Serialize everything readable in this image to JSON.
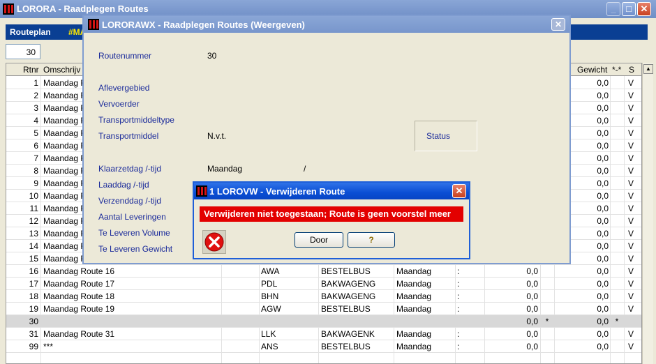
{
  "main_window": {
    "title": "LORORA - Raadplegen Routes",
    "routeplan_label": "Routeplan",
    "routeplan_code": "#MA",
    "count_value": "30"
  },
  "grid": {
    "headers": {
      "rtnr": "Rtnr",
      "omschrijving": "Omschrijv",
      "gewicht": "Gewicht",
      "flag": "*-*",
      "s": "S"
    },
    "rows": [
      {
        "rtnr": "1",
        "omschrijving": "Maandag Ro",
        "code": "",
        "vervoer": "",
        "dag": "",
        "tijd": "",
        "volume": "",
        "mark": "",
        "gewicht": "0,0",
        "flag": "",
        "s": "V"
      },
      {
        "rtnr": "2",
        "omschrijving": "Maandag Ro",
        "code": "",
        "vervoer": "",
        "dag": "",
        "tijd": "",
        "volume": "",
        "mark": "",
        "gewicht": "0,0",
        "flag": "",
        "s": "V"
      },
      {
        "rtnr": "3",
        "omschrijving": "Maandag Ro",
        "code": "",
        "vervoer": "",
        "dag": "",
        "tijd": "",
        "volume": "",
        "mark": "",
        "gewicht": "0,0",
        "flag": "",
        "s": "V"
      },
      {
        "rtnr": "4",
        "omschrijving": "Maandag Ro",
        "code": "",
        "vervoer": "",
        "dag": "",
        "tijd": "",
        "volume": "",
        "mark": "",
        "gewicht": "0,0",
        "flag": "",
        "s": "V"
      },
      {
        "rtnr": "5",
        "omschrijving": "Maandag Ro",
        "code": "",
        "vervoer": "",
        "dag": "",
        "tijd": "",
        "volume": "",
        "mark": "",
        "gewicht": "0,0",
        "flag": "",
        "s": "V"
      },
      {
        "rtnr": "6",
        "omschrijving": "Maandag Ro",
        "code": "",
        "vervoer": "",
        "dag": "",
        "tijd": "",
        "volume": "",
        "mark": "",
        "gewicht": "0,0",
        "flag": "",
        "s": "V"
      },
      {
        "rtnr": "7",
        "omschrijving": "Maandag Ro",
        "code": "",
        "vervoer": "",
        "dag": "",
        "tijd": "",
        "volume": "",
        "mark": "",
        "gewicht": "0,0",
        "flag": "",
        "s": "V"
      },
      {
        "rtnr": "8",
        "omschrijving": "Maandag Ro",
        "code": "",
        "vervoer": "",
        "dag": "",
        "tijd": "",
        "volume": "",
        "mark": "",
        "gewicht": "0,0",
        "flag": "",
        "s": "V"
      },
      {
        "rtnr": "9",
        "omschrijving": "Maandag Ro",
        "code": "",
        "vervoer": "",
        "dag": "",
        "tijd": "",
        "volume": "",
        "mark": "",
        "gewicht": "0,0",
        "flag": "",
        "s": "V"
      },
      {
        "rtnr": "10",
        "omschrijving": "Maandag Ro",
        "code": "",
        "vervoer": "",
        "dag": "",
        "tijd": "",
        "volume": "",
        "mark": "",
        "gewicht": "0,0",
        "flag": "",
        "s": "V"
      },
      {
        "rtnr": "11",
        "omschrijving": "Maandag Ro",
        "code": "",
        "vervoer": "",
        "dag": "",
        "tijd": "",
        "volume": "",
        "mark": "",
        "gewicht": "0,0",
        "flag": "",
        "s": "V"
      },
      {
        "rtnr": "12",
        "omschrijving": "Maandag Ro",
        "code": "",
        "vervoer": "",
        "dag": "",
        "tijd": "",
        "volume": "",
        "mark": "",
        "gewicht": "0,0",
        "flag": "",
        "s": "V"
      },
      {
        "rtnr": "13",
        "omschrijving": "Maandag Ro",
        "code": "",
        "vervoer": "",
        "dag": "",
        "tijd": "",
        "volume": "",
        "mark": "",
        "gewicht": "0,0",
        "flag": "",
        "s": "V"
      },
      {
        "rtnr": "14",
        "omschrijving": "Maandag Ro",
        "code": "",
        "vervoer": "",
        "dag": "",
        "tijd": "",
        "volume": "",
        "mark": "",
        "gewicht": "0,0",
        "flag": "",
        "s": "V"
      },
      {
        "rtnr": "15",
        "omschrijving": "Maandag Ro",
        "code": "",
        "vervoer": "",
        "dag": "",
        "tijd": "",
        "volume": "",
        "mark": "",
        "gewicht": "0,0",
        "flag": "",
        "s": "V"
      },
      {
        "rtnr": "16",
        "omschrijving": "Maandag Route 16",
        "code": "AWA",
        "vervoer": "BESTELBUS",
        "dag": "Maandag",
        "tijd": ":",
        "volume": "0,0",
        "mark": "",
        "gewicht": "0,0",
        "flag": "",
        "s": "V"
      },
      {
        "rtnr": "17",
        "omschrijving": "Maandag Route 17",
        "code": "PDL",
        "vervoer": "BAKWAGENG",
        "dag": "Maandag",
        "tijd": ":",
        "volume": "0,0",
        "mark": "",
        "gewicht": "0,0",
        "flag": "",
        "s": "V"
      },
      {
        "rtnr": "18",
        "omschrijving": "Maandag Route 18",
        "code": "BHN",
        "vervoer": "BAKWAGENG",
        "dag": "Maandag",
        "tijd": ":",
        "volume": "0,0",
        "mark": "",
        "gewicht": "0,0",
        "flag": "",
        "s": "V"
      },
      {
        "rtnr": "19",
        "omschrijving": "Maandag Route 19",
        "code": "AGW",
        "vervoer": "BESTELBUS",
        "dag": "Maandag",
        "tijd": ":",
        "volume": "0,0",
        "mark": "",
        "gewicht": "0,0",
        "flag": "",
        "s": "V"
      },
      {
        "rtnr": "30",
        "omschrijving": "",
        "code": "",
        "vervoer": "",
        "dag": "",
        "tijd": "",
        "volume": "0,0",
        "mark": "*",
        "gewicht": "0,0",
        "flag": "*",
        "s": "",
        "selected": true
      },
      {
        "rtnr": "31",
        "omschrijving": "Maandag Route 31",
        "code": "LLK",
        "vervoer": "BAKWAGENK",
        "dag": "Maandag",
        "tijd": ":",
        "volume": "0,0",
        "mark": "",
        "gewicht": "0,0",
        "flag": "",
        "s": "V"
      },
      {
        "rtnr": "99",
        "omschrijving": "***",
        "code": "ANS",
        "vervoer": "BESTELBUS",
        "dag": "Maandag",
        "tijd": ":",
        "volume": "0,0",
        "mark": "",
        "gewicht": "0,0",
        "flag": "",
        "s": "V"
      }
    ]
  },
  "detail_window": {
    "title": "LORORAWX - Raadplegen Routes (Weergeven)",
    "fields": {
      "routenummer_label": "Routenummer",
      "routenummer_value": "30",
      "aflevergebied_label": "Aflevergebied",
      "vervoerder_label": "Vervoerder",
      "transportmiddeltype_label": "Transportmiddeltype",
      "transportmiddel_label": "Transportmiddel",
      "transportmiddel_value": "N.v.t.",
      "klaarzetdag_label": "Klaarzetdag  /-tijd",
      "klaarzetdag_value": "Maandag",
      "klaarzetdag_sep": "/",
      "laaddag_label": "Laaddag     /-tijd",
      "verzenddag_label": "Verzenddag  /-tijd",
      "aantal_leveringen_label": "Aantal Leveringen",
      "te_leveren_volume_label": "Te Leveren Volume",
      "te_leveren_gewicht_label": "Te Leveren Gewicht",
      "status_label": "Status"
    }
  },
  "dialog": {
    "title": "1 LOROVW - Verwijderen Route",
    "message": "Verwijderen niet toegestaan; Route is geen voorstel meer",
    "door_button": "Door",
    "help_button": "?"
  },
  "colors": {
    "accent": "#0a3f93",
    "error": "#e30000",
    "routeplan_code": "#ffe800"
  }
}
